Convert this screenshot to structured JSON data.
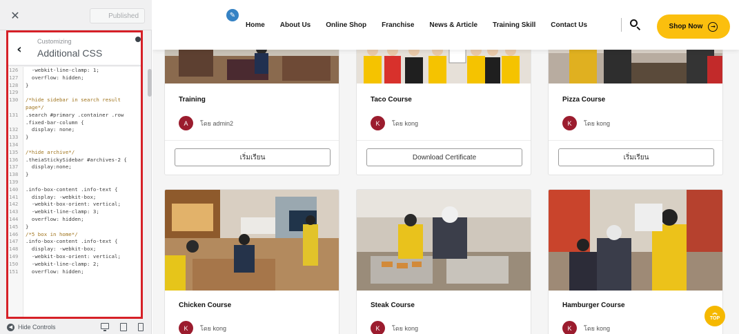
{
  "customizer": {
    "close_icon": "close-icon",
    "publish_label": "Published",
    "breadcrumb": "Customizing",
    "panel_title": "Additional CSS",
    "code_lines": [
      {
        "n": "126",
        "t": "  -webkit-line-clamp: 1;",
        "c": false
      },
      {
        "n": "127",
        "t": "  overflow: hidden;",
        "c": false
      },
      {
        "n": "128",
        "t": "}",
        "c": false
      },
      {
        "n": "129",
        "t": "",
        "c": false
      },
      {
        "n": "130",
        "t": "/*hide sidebar in search result",
        "c": true
      },
      {
        "n": "",
        "t": "page*/",
        "c": true
      },
      {
        "n": "131",
        "t": ".search #primary .container .row",
        "c": false
      },
      {
        "n": "",
        "t": ".fixed-bar-column {",
        "c": false
      },
      {
        "n": "132",
        "t": "  display: none;",
        "c": false
      },
      {
        "n": "133",
        "t": "}",
        "c": false
      },
      {
        "n": "134",
        "t": "",
        "c": false
      },
      {
        "n": "135",
        "t": "/*hide archive*/",
        "c": true
      },
      {
        "n": "136",
        "t": ".theiaStickySidebar #archives-2 {",
        "c": false
      },
      {
        "n": "137",
        "t": "  display:none;",
        "c": false
      },
      {
        "n": "138",
        "t": "}",
        "c": false
      },
      {
        "n": "139",
        "t": "",
        "c": false
      },
      {
        "n": "140",
        "t": ".info-box-content .info-text {",
        "c": false
      },
      {
        "n": "141",
        "t": "  display: -webkit-box;",
        "c": false
      },
      {
        "n": "142",
        "t": "  -webkit-box-orient: vertical;",
        "c": false
      },
      {
        "n": "143",
        "t": "  -webkit-line-clamp: 3;",
        "c": false
      },
      {
        "n": "144",
        "t": "  overflow: hidden;",
        "c": false
      },
      {
        "n": "145",
        "t": "}",
        "c": false
      },
      {
        "n": "146",
        "t": "/*5 box in home*/",
        "c": true
      },
      {
        "n": "147",
        "t": ".info-box-content .info-text {",
        "c": false
      },
      {
        "n": "148",
        "t": "  display: -webkit-box;",
        "c": false
      },
      {
        "n": "149",
        "t": "  -webkit-box-orient: vertical;",
        "c": false
      },
      {
        "n": "150",
        "t": "  -webkit-line-clamp: 2;",
        "c": false
      },
      {
        "n": "151",
        "t": "  overflow: hidden;",
        "c": false
      }
    ],
    "hide_controls_label": "Hide Controls"
  },
  "nav": {
    "links": [
      "Home",
      "About Us",
      "Online Shop",
      "Franchise",
      "News & Article",
      "Training Skill",
      "Contact Us"
    ],
    "shop_now_label": "Shop Now"
  },
  "cards": [
    {
      "title": "Training",
      "avatar": "A",
      "author": "โดย admin2",
      "button": "เริ่มเรียน"
    },
    {
      "title": "Taco Course",
      "avatar": "K",
      "author": "โดย kong",
      "button": "Download Certificate"
    },
    {
      "title": "Pizza Course",
      "avatar": "K",
      "author": "โดย kong",
      "button": "เริ่มเรียน"
    },
    {
      "title": "Chicken Course",
      "avatar": "K",
      "author": "โดย kong"
    },
    {
      "title": "Steak Course",
      "avatar": "K",
      "author": "โดย kong"
    },
    {
      "title": "Hamburger Course",
      "avatar": "K",
      "author": "โดย kong"
    }
  ],
  "top_button_label": "TOP",
  "colors": {
    "accent_yellow": "#fbbf0e",
    "avatar_maroon": "#9b1c2e",
    "highlight_red": "#d62027",
    "edit_blue": "#3582c4"
  }
}
